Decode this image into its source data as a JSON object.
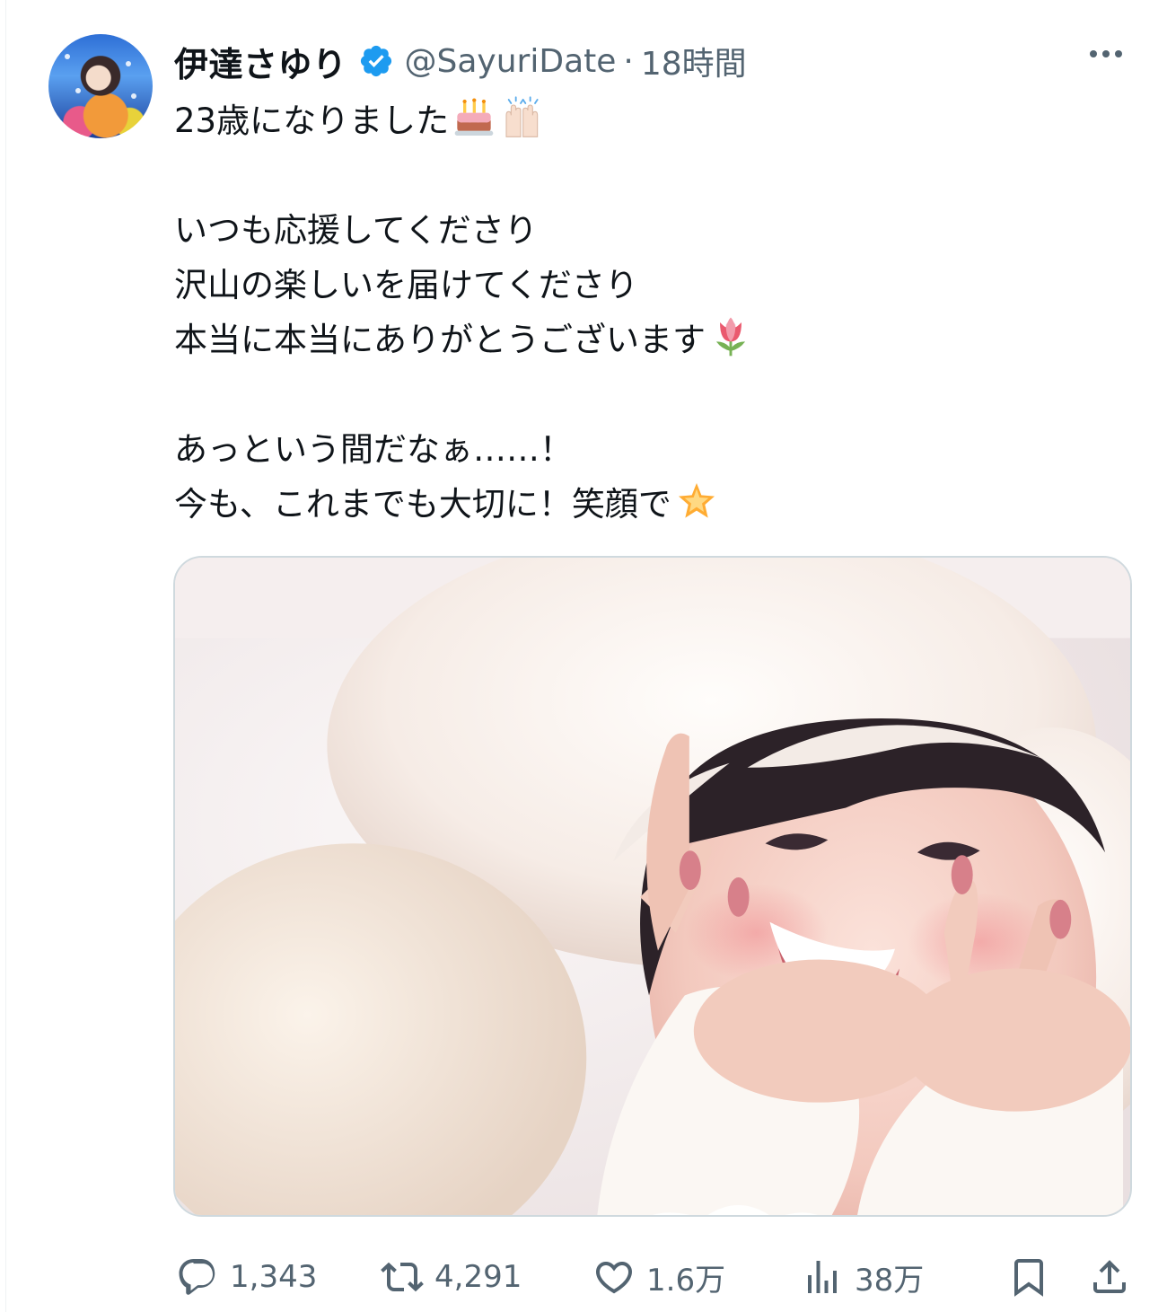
{
  "author": {
    "display_name": "伊達さゆり",
    "handle": "@SayuriDate",
    "separator": "·",
    "time": "18時間",
    "verified": true,
    "verified_color": "#1d9bf0"
  },
  "tweet": {
    "lines": [
      "23歳になりました",
      "",
      "いつも応援してくださり",
      "沢山の楽しいを届けてくださり",
      "本当に本当にありがとうございます",
      "",
      "あっという間だなぁ……！",
      "今も、これまでも大切に！笑顔で"
    ],
    "emojis": {
      "line0": [
        "birthday-cake",
        "raising-hands"
      ],
      "line4": [
        "tulip"
      ],
      "line7": [
        "glowing-star"
      ]
    }
  },
  "actions": {
    "reply_count": "1,343",
    "retweet_count": "4,291",
    "like_count": "1.6万",
    "views_count": "38万",
    "icons": [
      "reply-icon",
      "retweet-icon",
      "like-icon",
      "views-icon",
      "bookmark-icon",
      "share-icon"
    ]
  },
  "colors": {
    "text": "#0f1419",
    "secondary": "#536471",
    "border": "#cfd9de"
  }
}
